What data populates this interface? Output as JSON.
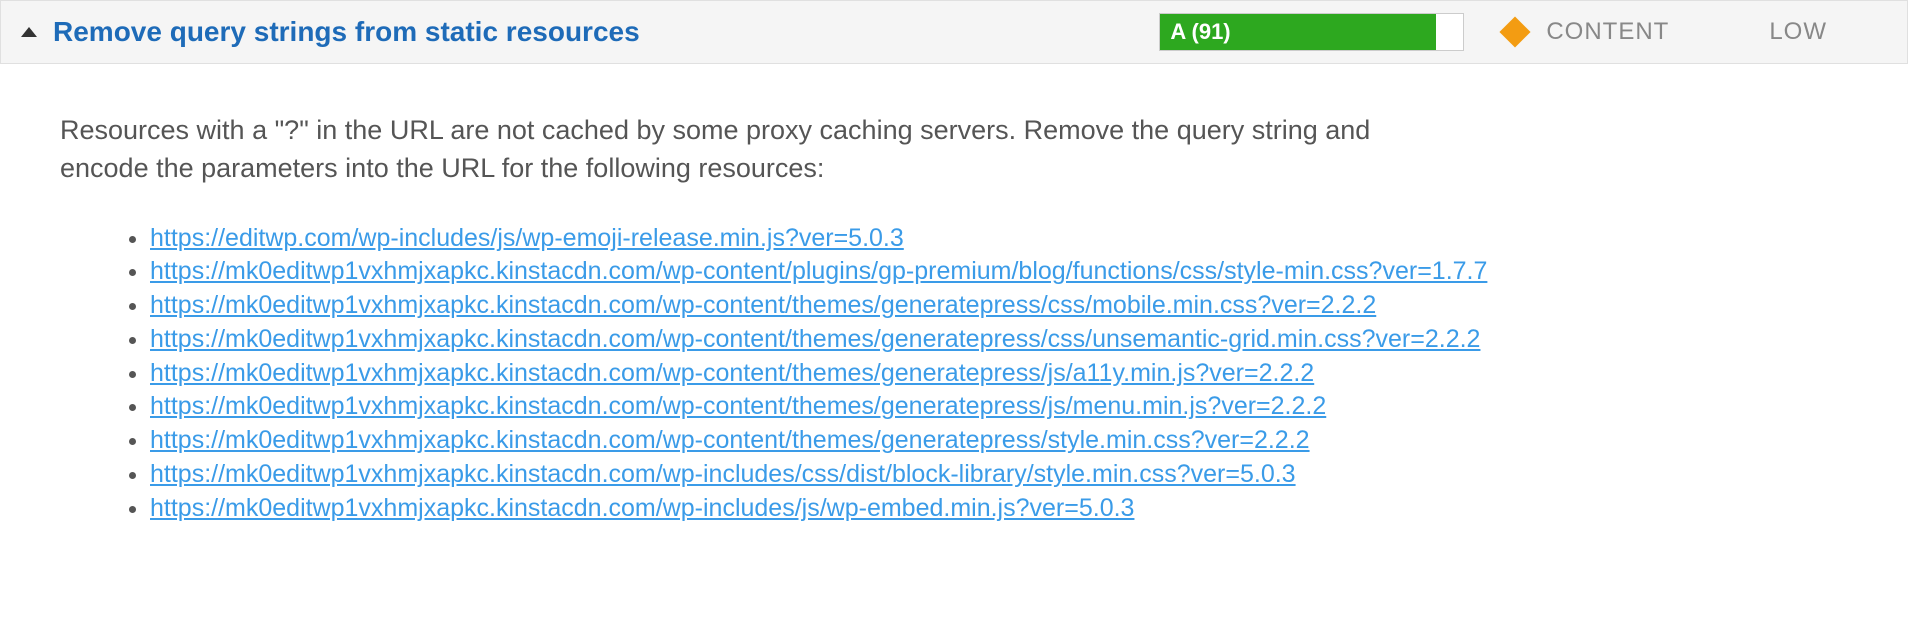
{
  "header": {
    "title": "Remove query strings from static resources",
    "score_label": "A (91)",
    "score_percent": 91,
    "type_label": "CONTENT",
    "priority_label": "LOW"
  },
  "body": {
    "description": "Resources with a \"?\" in the URL are not cached by some proxy caching servers. Remove the query string and encode the parameters into the URL for the following resources:",
    "urls": [
      "https://editwp.com/wp-includes/js/wp-emoji-release.min.js?ver=5.0.3",
      "https://mk0editwp1vxhmjxapkc.kinstacdn.com/wp-content/plugins/gp-premium/blog/functions/css/style-min.css?ver=1.7.7",
      "https://mk0editwp1vxhmjxapkc.kinstacdn.com/wp-content/themes/generatepress/css/mobile.min.css?ver=2.2.2",
      "https://mk0editwp1vxhmjxapkc.kinstacdn.com/wp-content/themes/generatepress/css/unsemantic-grid.min.css?ver=2.2.2",
      "https://mk0editwp1vxhmjxapkc.kinstacdn.com/wp-content/themes/generatepress/js/a11y.min.js?ver=2.2.2",
      "https://mk0editwp1vxhmjxapkc.kinstacdn.com/wp-content/themes/generatepress/js/menu.min.js?ver=2.2.2",
      "https://mk0editwp1vxhmjxapkc.kinstacdn.com/wp-content/themes/generatepress/style.min.css?ver=2.2.2",
      "https://mk0editwp1vxhmjxapkc.kinstacdn.com/wp-includes/css/dist/block-library/style.min.css?ver=5.0.3",
      "https://mk0editwp1vxhmjxapkc.kinstacdn.com/wp-includes/js/wp-embed.min.js?ver=5.0.3"
    ]
  }
}
